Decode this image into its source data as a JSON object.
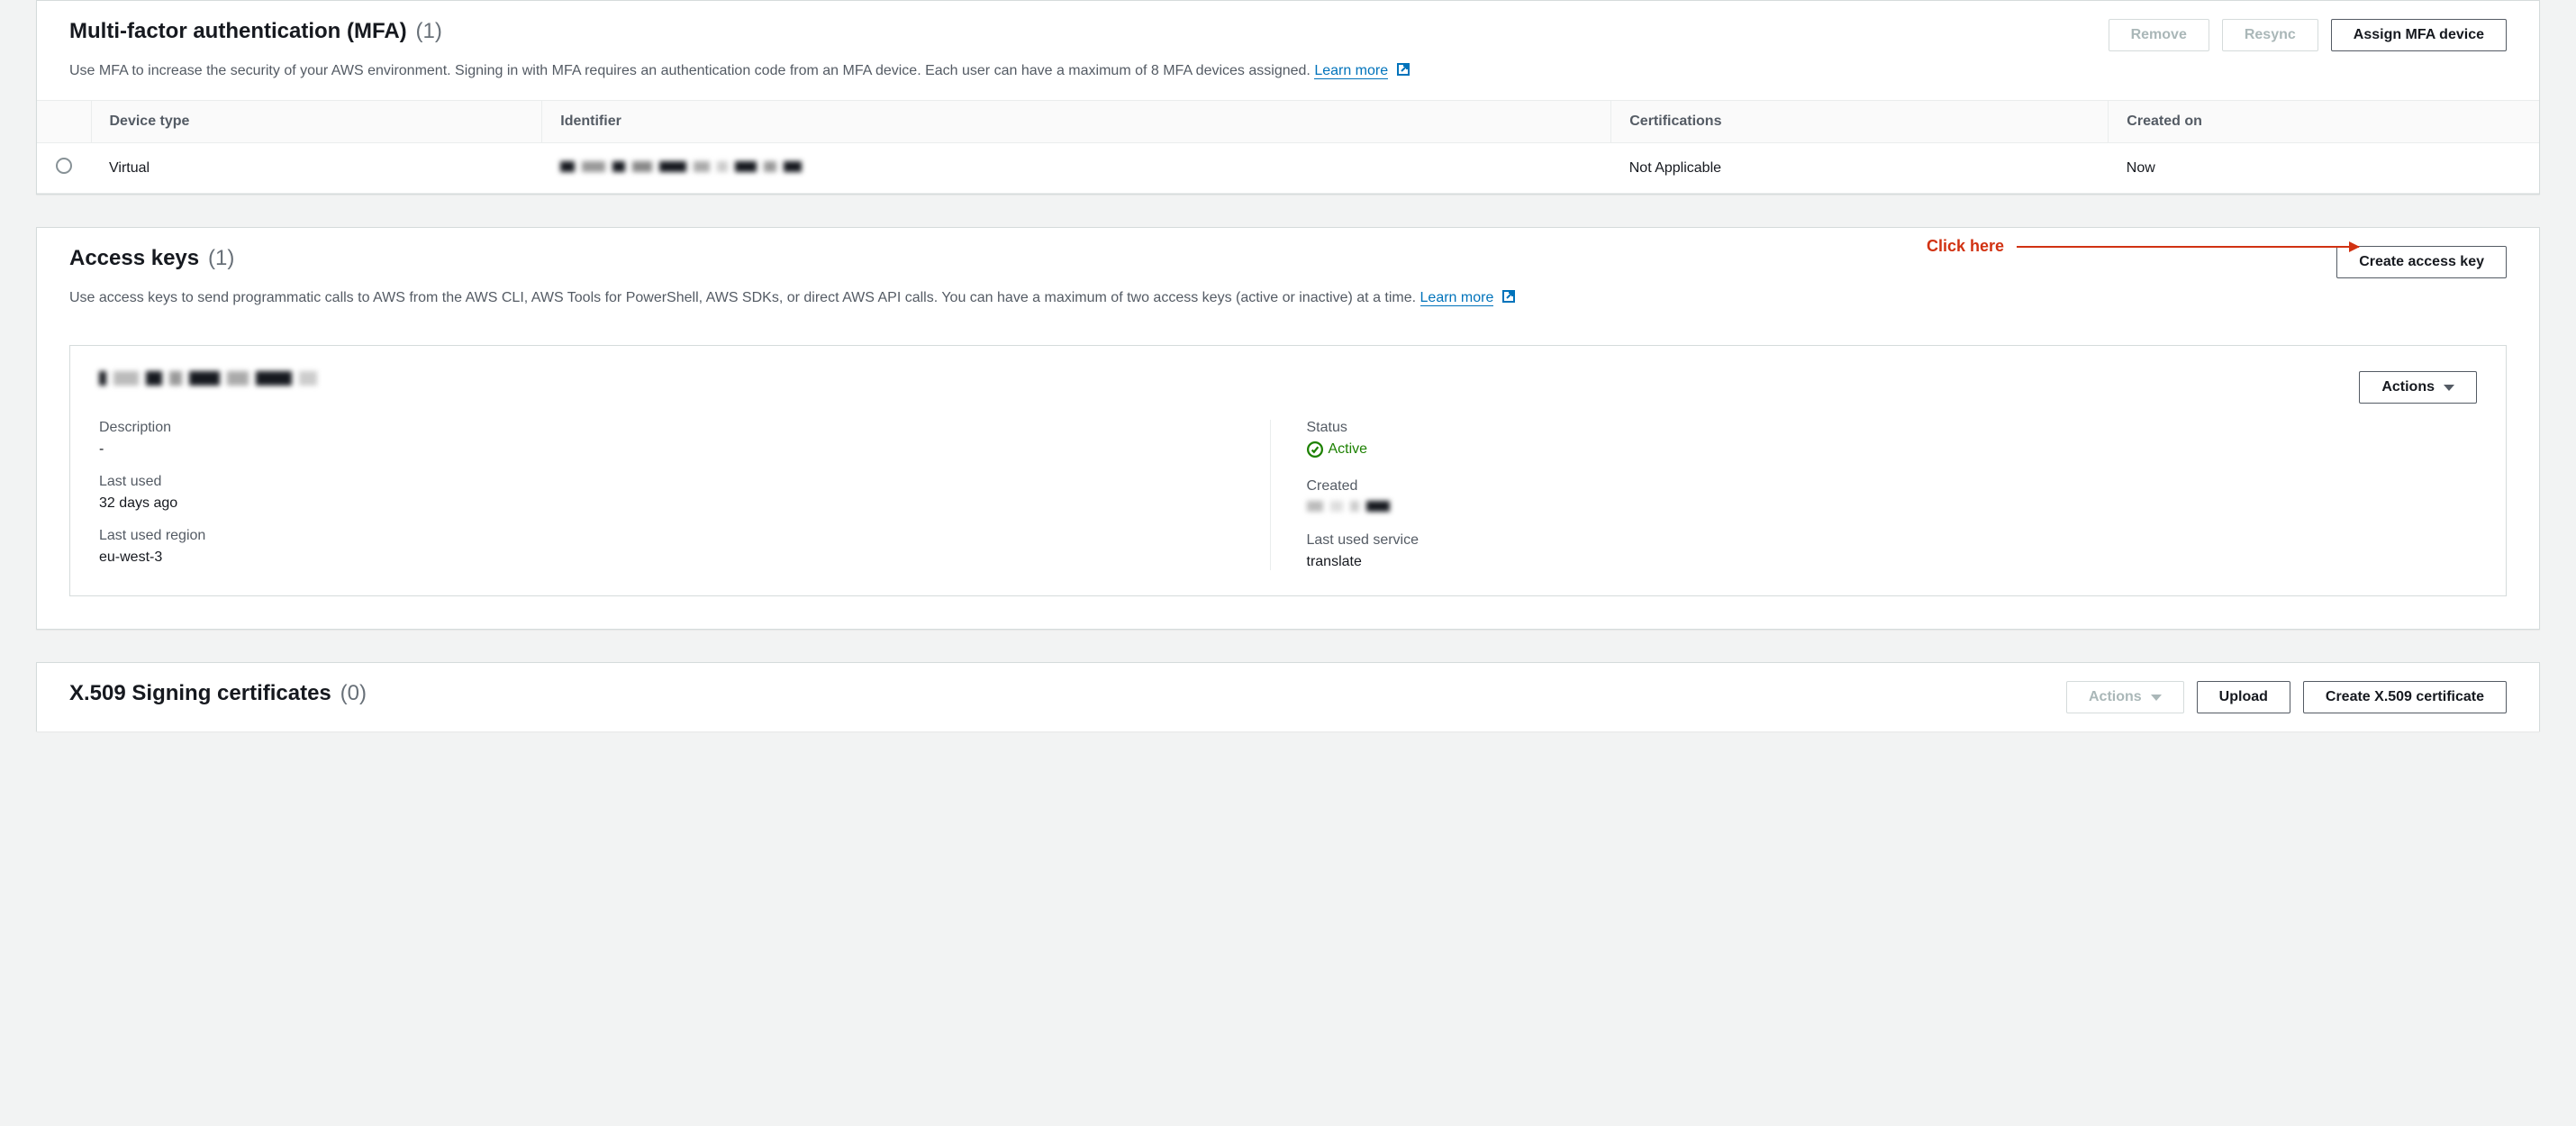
{
  "mfa": {
    "title": "Multi-factor authentication (MFA)",
    "count": "(1)",
    "description": "Use MFA to increase the security of your AWS environment. Signing in with MFA requires an authentication code from an MFA device. Each user can have a maximum of 8 MFA devices assigned. ",
    "learn_more": "Learn more",
    "buttons": {
      "remove": "Remove",
      "resync": "Resync",
      "assign": "Assign MFA device"
    },
    "columns": {
      "device_type": "Device type",
      "identifier": "Identifier",
      "certifications": "Certifications",
      "created_on": "Created on"
    },
    "row": {
      "device_type": "Virtual",
      "identifier_redacted": true,
      "certifications": "Not Applicable",
      "created_on": "Now"
    }
  },
  "access": {
    "title": "Access keys",
    "count": "(1)",
    "description": "Use access keys to send programmatic calls to AWS from the AWS CLI, AWS Tools for PowerShell, AWS SDKs, or direct AWS API calls. You can have a maximum of two access keys (active or inactive) at a time. ",
    "learn_more": "Learn more",
    "create_btn": "Create access key",
    "annotation": "Click here",
    "card": {
      "actions": "Actions",
      "labels": {
        "description": "Description",
        "status": "Status",
        "last_used": "Last used",
        "created": "Created",
        "last_used_region": "Last used region",
        "last_used_service": "Last used service"
      },
      "values": {
        "description": "-",
        "status": "Active",
        "last_used": "32 days ago",
        "created_redacted": true,
        "last_used_region": "eu-west-3",
        "last_used_service": "translate"
      }
    }
  },
  "x509": {
    "title": "X.509 Signing certificates",
    "count": "(0)",
    "buttons": {
      "actions": "Actions",
      "upload": "Upload",
      "create": "Create X.509 certificate"
    }
  }
}
